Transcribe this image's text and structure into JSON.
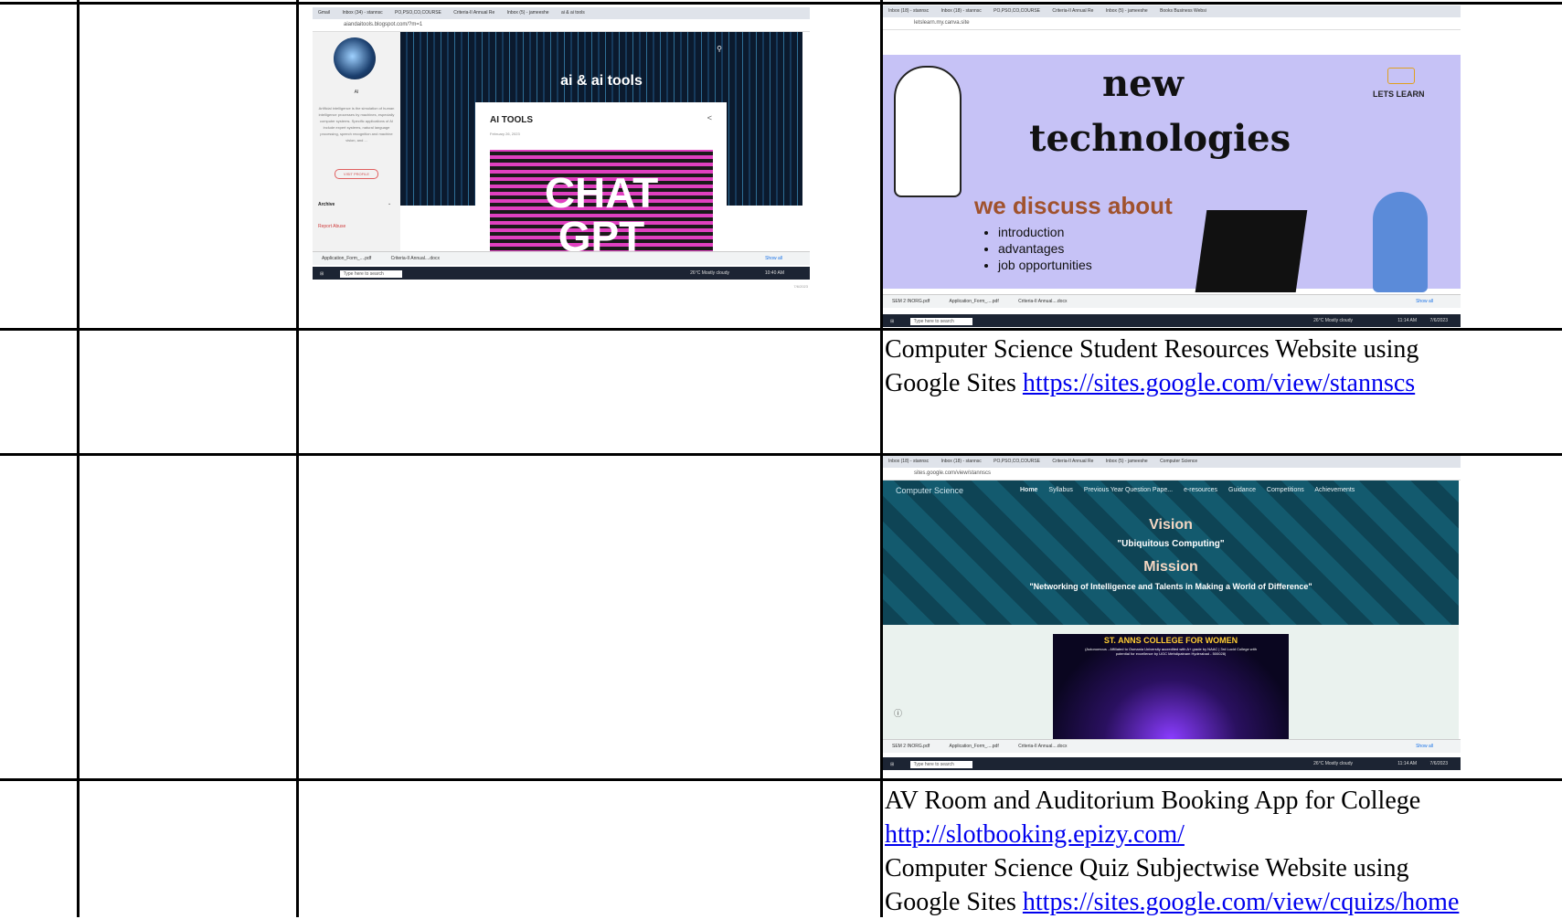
{
  "rows": {
    "row2": {
      "title": "Computer Science Student Resources Website using",
      "prefix": "Google Sites ",
      "link": "https://sites.google.com/view/stannscs"
    },
    "row4": {
      "title1": "AV Room and Auditorium Booking App for College",
      "link1": "http://slotbooking.epizy.com/",
      "title2": "Computer Science Quiz Subjectwise Website using",
      "prefix2": "Google Sites ",
      "link2": "https://sites.google.com/view/cquizs/home"
    }
  },
  "shot_blog": {
    "url": "aiandaitools.blogspot.com/?m=1",
    "tabs": [
      "Gmail",
      "Inbox (34) - stannsc",
      "PO,PSO,CO,COURSE",
      "Criteria-II Annual Re",
      "Inbox (5) - jameeshe",
      "ai & ai tools"
    ],
    "blog_title": "ai & ai tools",
    "profile_name": "AI",
    "profile_text": "Artificial intelligence is the simulation of human intelligence processes by machines, especially computer systems. Specific applications of AI include expert systems, natural language processing, speech recognition and machine vision, and ...",
    "visit_profile": "VISIT PROFILE",
    "archive": "Archive",
    "report_abuse": "Report Abuse",
    "post_title": "AI TOOLS",
    "post_date": "February 26, 2023",
    "image_text1": "CHAT",
    "image_text2": "GPT",
    "downloads": [
      "Application_Form_....pdf",
      "Criteria-II Annual....docx"
    ],
    "show_all": "Show all",
    "taskbar_search": "Type here to search",
    "weather": "26°C  Mostly cloudy",
    "time": "10:40 AM",
    "date": "7/6/2023"
  },
  "shot_canva": {
    "url": "letslearn.my.canva.site",
    "tabs": [
      "Inbox (18) - stannsc",
      "Inbox (18) - stannsc",
      "PO,PSO,CO,COURSE",
      "Criteria-II Annual Re",
      "Inbox (5) - jameeshe",
      "Books Business Websi"
    ],
    "heading1": "new",
    "heading2": "technologies",
    "logo_text": "LETS LEARN",
    "subheading": "we discuss about",
    "bullets": [
      "introduction",
      "advantages",
      "job opportunities"
    ],
    "downloads": [
      "SEM 2 INORG.pdf",
      "Application_Form_....pdf",
      "Criteria-II Annual....docx"
    ],
    "show_all": "Show all",
    "taskbar_search": "Type here to search",
    "weather": "26°C  Mostly cloudy",
    "time": "11:14 AM",
    "date": "7/6/2023"
  },
  "shot_sites": {
    "url": "sites.google.com/view/stannscs",
    "tabs": [
      "Inbox (18) - stannsc",
      "Inbox (18) - stannsc",
      "PO,PSO,CO,COURSE",
      "Criteria-II Annual Re",
      "Inbox (5) - jameeshe",
      "Computer Science"
    ],
    "site_name": "Computer Science",
    "nav": [
      "Home",
      "Syllabus",
      "Previous Year Question Pape...",
      "e-resources",
      "Guidance",
      "Competitions",
      "Achievements"
    ],
    "vision": "Vision",
    "vision_text": "\"Ubiquitous Computing\"",
    "mission": "Mission",
    "mission_text": "\"Networking of Intelligence and Talents in Making a World of Difference\"",
    "college": "ST. ANNS COLLEGE FOR WOMEN",
    "college_sub": "(Autonomous - Affiliated to Osmania University accredited with A+ grade by NAAC | 3rd Lucid College with potential for excellence by UGC Mehdipatnam Hyderabad - 500028)",
    "downloads": [
      "SEM 2 INORG.pdf",
      "Application_Form_....pdf",
      "Criteria-II Annual....docx"
    ],
    "show_all": "Show all",
    "taskbar_search": "Type here to search",
    "weather": "26°C  Mostly cloudy",
    "time": "11:14 AM",
    "date": "7/6/2023"
  }
}
